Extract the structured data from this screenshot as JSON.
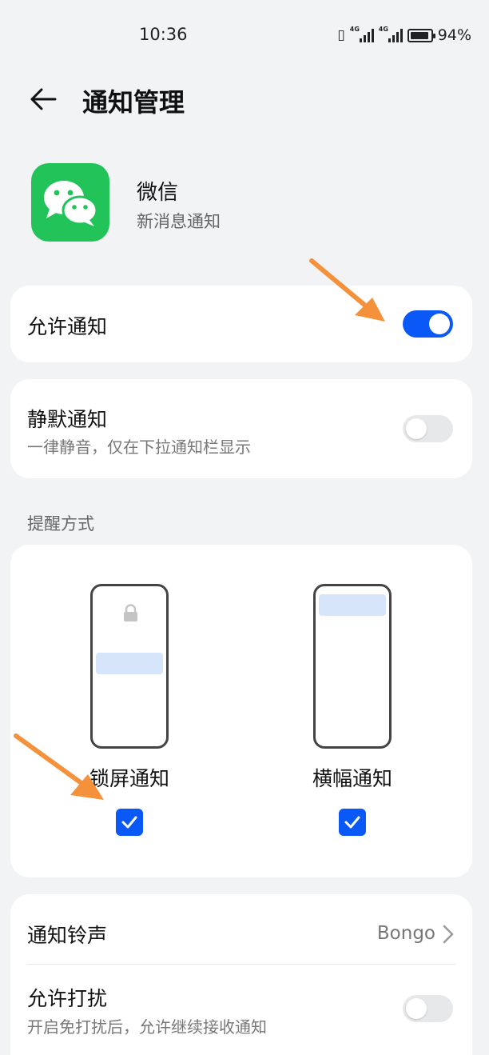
{
  "status_bar": {
    "time": "10:36",
    "network_1": "4G",
    "network_2": "4G",
    "battery_text": "94%",
    "battery_level": 0.94
  },
  "header": {
    "title": "通知管理"
  },
  "app": {
    "name": "微信",
    "subtitle": "新消息通知",
    "brand_color": "#22c45a"
  },
  "allow_notifications": {
    "label": "允许通知",
    "enabled": true
  },
  "silent_notifications": {
    "label": "静默通知",
    "description": "一律静音，仅在下拉通知栏显示",
    "enabled": false
  },
  "reminder": {
    "section_label": "提醒方式",
    "options": [
      {
        "label": "锁屏通知",
        "checked": true
      },
      {
        "label": "横幅通知",
        "checked": true
      }
    ]
  },
  "ringtone": {
    "label": "通知铃声",
    "value": "Bongo"
  },
  "dnd": {
    "label": "允许打扰",
    "description": "开启免打扰后，允许继续接收通知",
    "enabled": false
  },
  "colors": {
    "accent": "#0a59f7",
    "annotation_arrow": "#f5913b",
    "background": "#f1f3f5"
  },
  "icons": [
    "vibrate-icon",
    "signal-icon",
    "battery-icon",
    "back-arrow-icon",
    "wechat-logo-icon",
    "lock-icon",
    "check-icon",
    "chevron-right-icon"
  ]
}
